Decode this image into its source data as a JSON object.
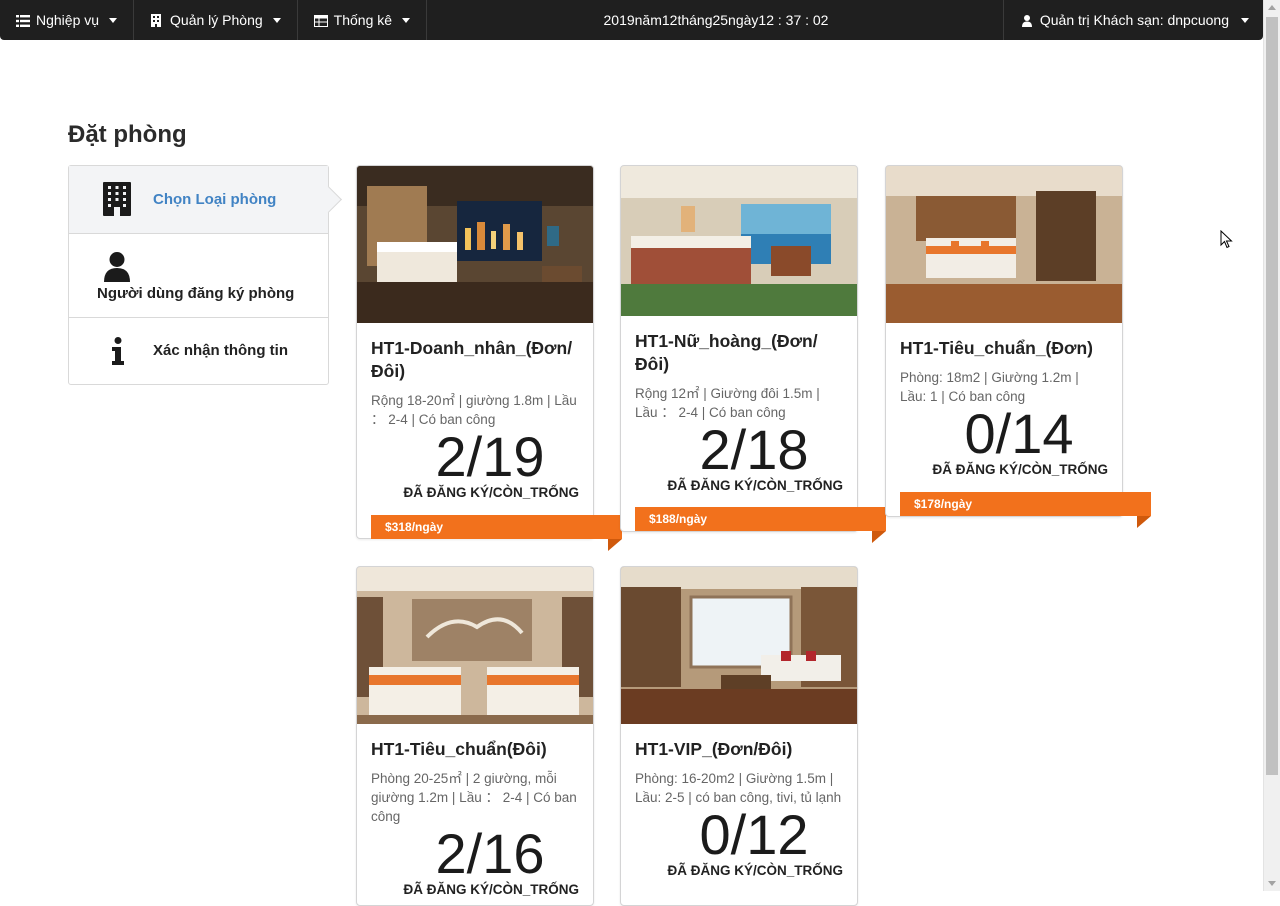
{
  "navbar": {
    "items": [
      {
        "label": "Nghiệp vụ",
        "icon": "list-icon"
      },
      {
        "label": "Quản lý Phòng",
        "icon": "building-icon"
      },
      {
        "label": "Thống kê",
        "icon": "table-icon"
      }
    ],
    "clock": "2019năm12tháng25ngày12 : 37 : 02",
    "user": "Quản trị Khách sạn: dnpcuong"
  },
  "page": {
    "title": "Đặt phòng"
  },
  "steps": [
    {
      "label": "Chọn Loại phòng",
      "icon": "building-icon",
      "active": true
    },
    {
      "label": "Người dùng đăng ký phòng",
      "icon": "user-icon",
      "active": false
    },
    {
      "label": "Xác nhận thông tin",
      "icon": "info-icon",
      "active": false
    }
  ],
  "rooms": [
    {
      "name": "HT1-Doanh_nhân_(Đơn/ Đôi)",
      "desc": "Rộng 18-20㎡ | giường 1.8m | Lầu ： 2-4 | Có ban công",
      "ratio": "2/19",
      "caption": "ĐÃ ĐĂNG KÝ/CÒN_TRỐNG",
      "price": "$318/ngày"
    },
    {
      "name": "HT1-Nữ_hoàng_(Đơn/ Đôi)",
      "desc": "Rộng 12㎡ | Giường đôi 1.5m | Lầu ： 2-4 | Có ban công",
      "ratio": "2/18",
      "caption": "ĐÃ ĐĂNG KÝ/CÒN_TRỐNG",
      "price": "$188/ngày"
    },
    {
      "name": "HT1-Tiêu_chuẩn_(Đơn)",
      "desc": "Phòng: 18m2 | Giường 1.2m | Lầu: 1 | Có ban công",
      "ratio": "0/14",
      "caption": "ĐÃ ĐĂNG KÝ/CÒN_TRỐNG",
      "price": "$178/ngày"
    },
    {
      "name": "HT1-Tiêu_chuẩn(Đôi)",
      "desc": "Phòng 20-25㎡ | 2 giường, mỗi giường 1.2m | Lầu ： 2-4 | Có ban công",
      "ratio": "2/16",
      "caption": "ĐÃ ĐĂNG KÝ/CÒN_TRỐNG",
      "price": ""
    },
    {
      "name": "HT1-VIP_(Đơn/Đôi)",
      "desc": "Phòng: 16-20m2 | Giường 1.5m | Lầu: 2-5 | có ban công, tivi, tủ lạnh",
      "ratio": "0/12",
      "caption": "ĐÃ ĐĂNG KÝ/CÒN_TRỐNG",
      "price": ""
    }
  ],
  "colors": {
    "navbar": "#1f1f1f",
    "accent": "#4183c4",
    "ribbon": "#f2711c"
  }
}
